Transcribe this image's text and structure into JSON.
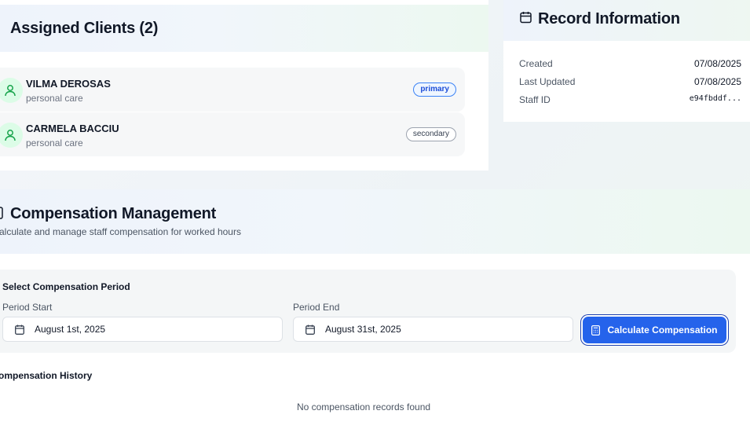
{
  "clients": {
    "title": "Assigned Clients (2)",
    "items": [
      {
        "name": "VILMA DEROSAS",
        "service": "personal care",
        "role": "primary"
      },
      {
        "name": "CARMELA BACCIU",
        "service": "personal care",
        "role": "secondary"
      }
    ]
  },
  "record": {
    "title": "Record Information",
    "rows": [
      {
        "label": "Created",
        "value": "07/08/2025"
      },
      {
        "label": "Last Updated",
        "value": "07/08/2025"
      },
      {
        "label": "Staff ID",
        "value": "e94fbddf..."
      }
    ]
  },
  "compensation": {
    "title": "Compensation Management",
    "subtitle": "alculate and manage staff compensation for worked hours",
    "period_heading": "Select Compensation Period",
    "period_start_label": "Period Start",
    "period_start_value": "August 1st, 2025",
    "period_end_label": "Period End",
    "period_end_value": "August 31st, 2025",
    "calculate_label": "Calculate Compensation",
    "history_heading": "ompensation History",
    "empty_message": "No compensation records found"
  },
  "colors": {
    "accent": "#2563eb",
    "avatar_bg": "#dcfce7",
    "avatar_icon": "#16a34a"
  },
  "icons": [
    "users-icon",
    "user-icon",
    "calendar-icon",
    "calculator-icon"
  ]
}
